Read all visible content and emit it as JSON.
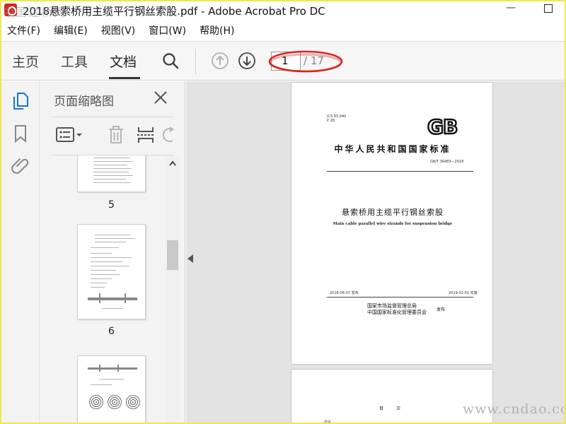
{
  "window": {
    "title": "2018悬索桥用主缆平行钢丝索股.pdf - Adobe Acrobat Pro DC",
    "minimize_glyph": "—",
    "watermark": "中国过桥网"
  },
  "menu": [
    "文件(F)",
    "编辑(E)",
    "视图(V)",
    "窗口(W)",
    "帮助(H)"
  ],
  "toolbar": {
    "tabs": [
      "主页",
      "工具",
      "文档"
    ],
    "active_tab": "文档",
    "page_current": "1",
    "page_total": "/ 17"
  },
  "thumb_panel": {
    "title": "页面缩略图",
    "thumbs": [
      {
        "number": "5"
      },
      {
        "number": "6"
      }
    ]
  },
  "document": {
    "page1": {
      "ics": "ICS 93.040",
      "ccs": "P 28",
      "logo": "GB",
      "heading": "中华人民共和国国家标准",
      "code": "GB/T 36483—2018",
      "title_cn": "悬索桥用主缆平行钢丝索股",
      "title_en": "Main cable parallel wire strands for suspension bridge",
      "published": "2018-06-07 发布",
      "effective": "2019-01-01 实施",
      "issuer_1": "国家市场监督管理总局",
      "issuer_2": "中国国家标准化管理委员会",
      "issued_word": "发布"
    },
    "page2": {
      "toc_title": "目  次",
      "toc_entry": "前言"
    }
  },
  "site_watermark": "www.cndao.com",
  "colors": {
    "frame_border": "#f2e84b",
    "annotation_red": "#d9261c",
    "icon_blue": "#1473e6"
  }
}
